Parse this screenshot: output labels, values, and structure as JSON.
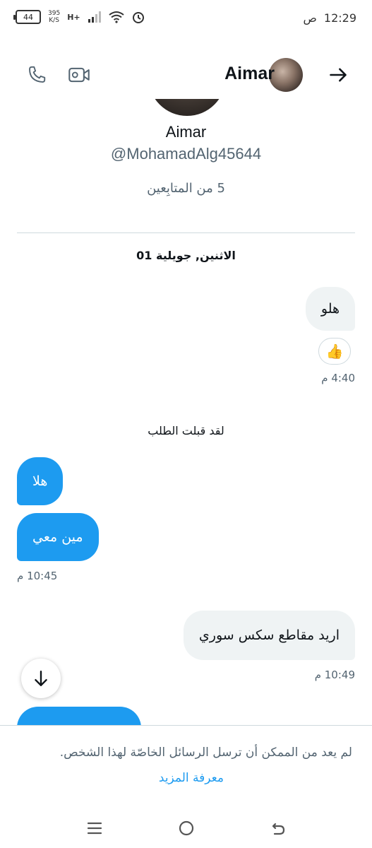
{
  "status_bar": {
    "battery": "44",
    "speed_value": "395",
    "speed_unit": "K/S",
    "network": "H+",
    "time": "12:29",
    "period": "ص"
  },
  "header": {
    "title": "Aimar"
  },
  "profile": {
    "name": "Aimar",
    "handle": "@MohamadAlg45644",
    "followers": "5 من المتابِعين"
  },
  "conversation": {
    "date": "الاثنين, جويلية 01",
    "messages": [
      {
        "direction": "sent",
        "text": "هلو"
      },
      {
        "direction": "received",
        "text": "هلا"
      },
      {
        "direction": "received",
        "text": "مين معي"
      },
      {
        "direction": "sent",
        "text": "اريد مقاطع سكس سوري"
      }
    ],
    "reaction": "👍",
    "time_1": "4:40 م",
    "system_message": "لقد قبلت الطلب",
    "time_2": "10:45 م",
    "time_3": "10:49 م"
  },
  "notice": {
    "text": "لم يعد من الممكن أن ترسل الرسائل الخاصّة لهذا الشخص.",
    "link": "معرفة المزيد"
  },
  "colors": {
    "accent": "#1d9bf0",
    "sent_bubble": "#eff3f4",
    "muted_text": "#536471"
  }
}
